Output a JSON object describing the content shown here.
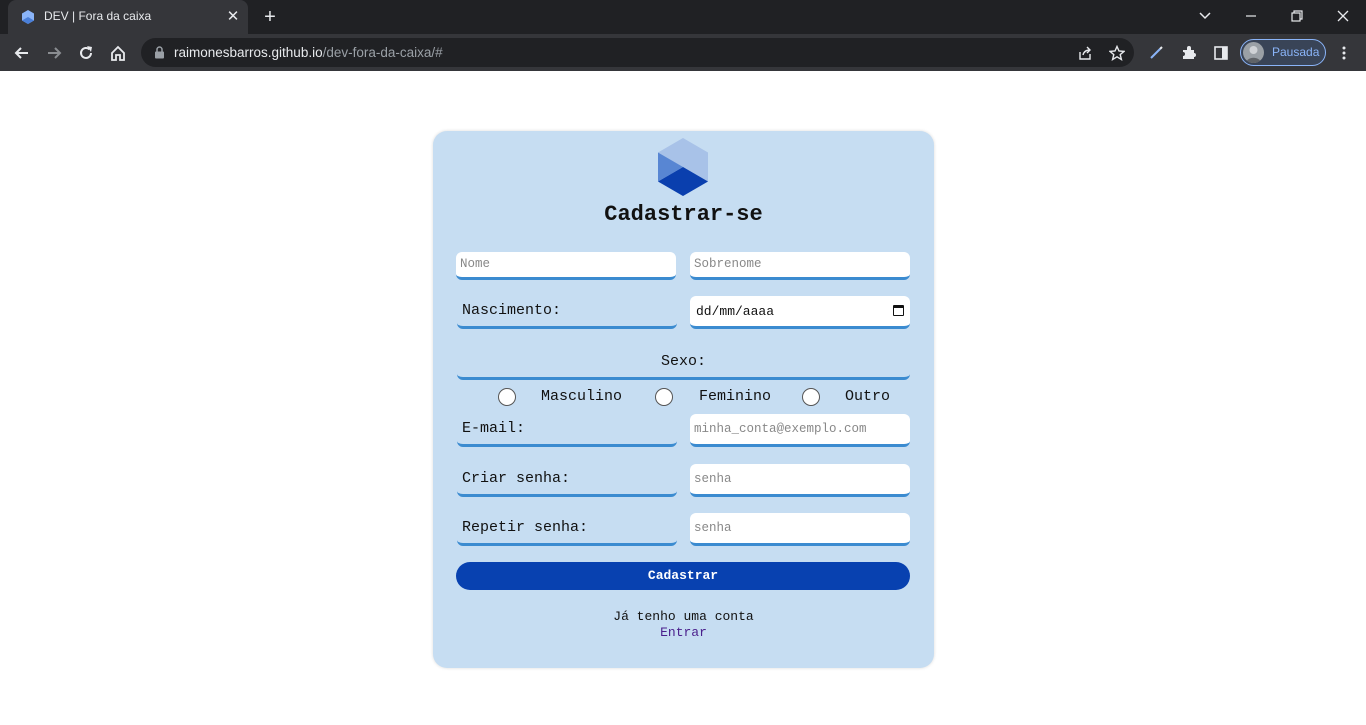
{
  "browser": {
    "tab_title": "DEV | Fora da caixa",
    "url_host": "raimonesbarros.github.io",
    "url_path": "/dev-fora-da-caixa/#",
    "profile_label": "Pausada",
    "colors": {
      "frame": "#202124",
      "toolbar": "#35363a",
      "accent": "#8ab4f8"
    },
    "icons": [
      "back-icon",
      "forward-icon",
      "reload-icon",
      "home-icon",
      "lock-icon",
      "share-icon",
      "star-icon",
      "pen-icon",
      "extensions-icon",
      "side-panel-icon",
      "menu-icon"
    ]
  },
  "form": {
    "title": "Cadastrar-se",
    "first_name_placeholder": "Nome",
    "last_name_placeholder": "Sobrenome",
    "birth_label": "Nascimento:",
    "birth_date_placeholder": "dd/mm/aaaa",
    "sex_label": "Sexo:",
    "sex_options": [
      "Masculino",
      "Feminino",
      "Outro"
    ],
    "email_label": "E-mail:",
    "email_placeholder": "minha_conta@exemplo.com",
    "password_label": "Criar senha:",
    "password_placeholder": "senha",
    "repeat_password_label": "Repetir senha:",
    "repeat_password_placeholder": "senha",
    "submit_label": "Cadastrar",
    "has_account_text": "Já tenho uma conta",
    "login_link": "Entrar",
    "colors": {
      "card": "#c6ddf2",
      "field_underline": "#3b8bd0",
      "button": "#0841b0",
      "link": "#4a1f8c"
    }
  }
}
